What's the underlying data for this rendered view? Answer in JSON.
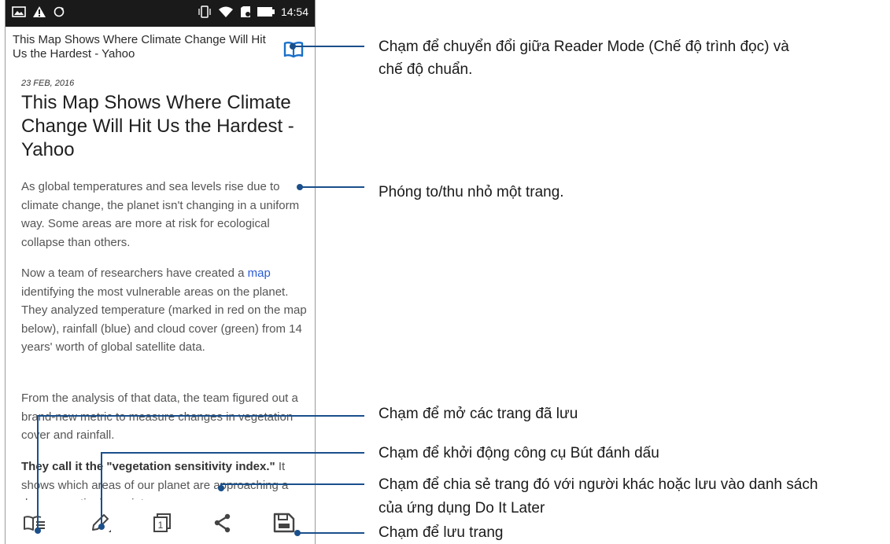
{
  "status_bar": {
    "time": "14:54",
    "left_icons": [
      "image-icon",
      "warning-icon",
      "sync-icon"
    ],
    "right_icons": [
      "vibrate-icon",
      "wifi-icon",
      "sd-card-icon",
      "battery-icon"
    ]
  },
  "browser": {
    "page_title": "This Map Shows Where Climate Change Will Hit Us the Hardest - Yahoo",
    "reader_icon": "book-icon"
  },
  "article": {
    "date": "23 FEB, 2016",
    "headline": "This Map Shows Where Climate Change Will Hit Us the Hardest - Yahoo",
    "p1": "As global temperatures and sea levels rise due to climate change, the planet isn't changing in a uniform way. Some areas are more at risk for ecological collapse than others.",
    "p2_pre": "Now a team of researchers have created a ",
    "p2_link": "map",
    "p2_post": " identifying the most vulnerable areas on the planet. They analyzed temperature (marked in red on the map below), rainfall (blue) and cloud cover (green) from 14 years' worth of global satellite data.",
    "p3": "From the analysis of that data, the team figured out a brand-new metric to measure changes in vegetation cover and rainfall.",
    "p4_bold": "They call it the \"vegetation sensitivity index.\"",
    "p4_rest": " It shows which areas of our planet are approaching a dangerous tipping point."
  },
  "bottom_bar": {
    "icons": [
      "saved-pages-icon",
      "highlighter-icon",
      "tabs-icon",
      "share-icon",
      "save-page-icon"
    ],
    "tab_count": "1"
  },
  "annotations": {
    "reader_mode_line1": "Chạm để chuyển đổi giữa Reader Mode (Chế độ trình đọc) và",
    "reader_mode_line2": "chế độ chuẩn.",
    "zoom": "Phóng to/thu nhỏ một trang.",
    "open_saved": "Chạm để mở các trang đã lưu",
    "highlighter": "Chạm để khởi động công cụ Bút đánh dấu",
    "share_line1": "Chạm để chia sẻ trang đó với người khác hoặc lưu vào danh sách",
    "share_line2": "của ứng dụng Do It Later",
    "save": "Chạm để lưu trang"
  },
  "colors": {
    "callout": "#1a4f8b",
    "status_bar_bg": "#1a1a1a",
    "link": "#2b5bd6"
  }
}
